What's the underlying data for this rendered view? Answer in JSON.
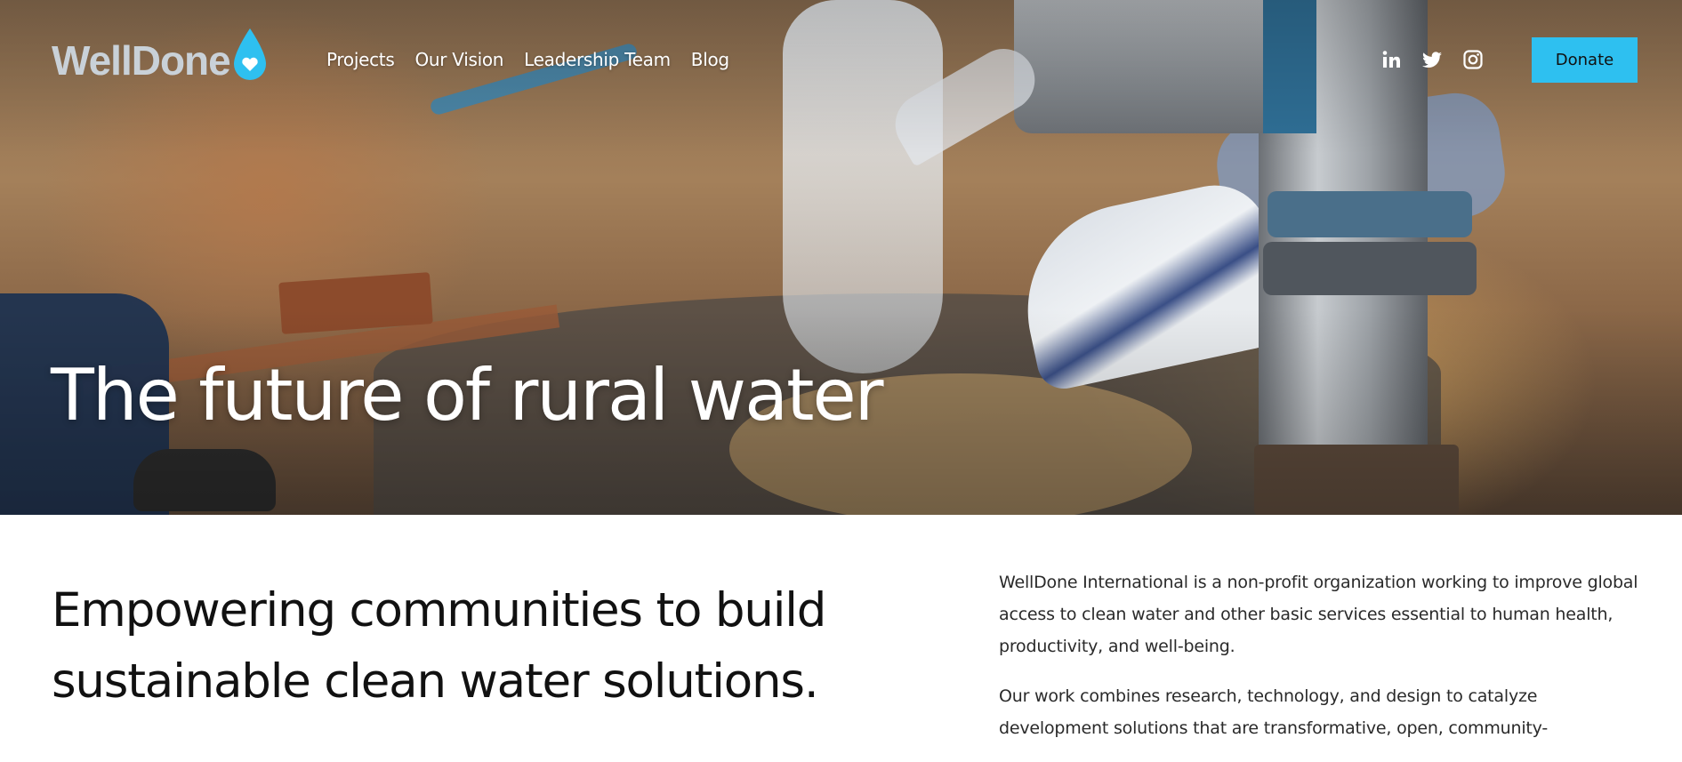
{
  "brand": {
    "name": "WellDone",
    "accent_color": "#2ec0f0"
  },
  "nav": {
    "links": [
      "Projects",
      "Our Vision",
      "Leadership Team",
      "Blog"
    ],
    "social": [
      {
        "icon": "linkedin-icon",
        "label": "in"
      },
      {
        "icon": "twitter-icon",
        "label": "twitter"
      },
      {
        "icon": "instagram-icon",
        "label": "instagram"
      }
    ],
    "donate_label": "Donate"
  },
  "hero": {
    "title": "The future of rural water"
  },
  "intro": {
    "headline": "Empowering communities to build sustainable clean water solutions.",
    "paragraphs": [
      "WellDone International is a non-profit organization working to improve global access to clean water and other basic services essential to human health, productivity, and well-being.",
      "Our work combines research, technology, and design to catalyze development solutions that are transformative, open, community-"
    ]
  }
}
